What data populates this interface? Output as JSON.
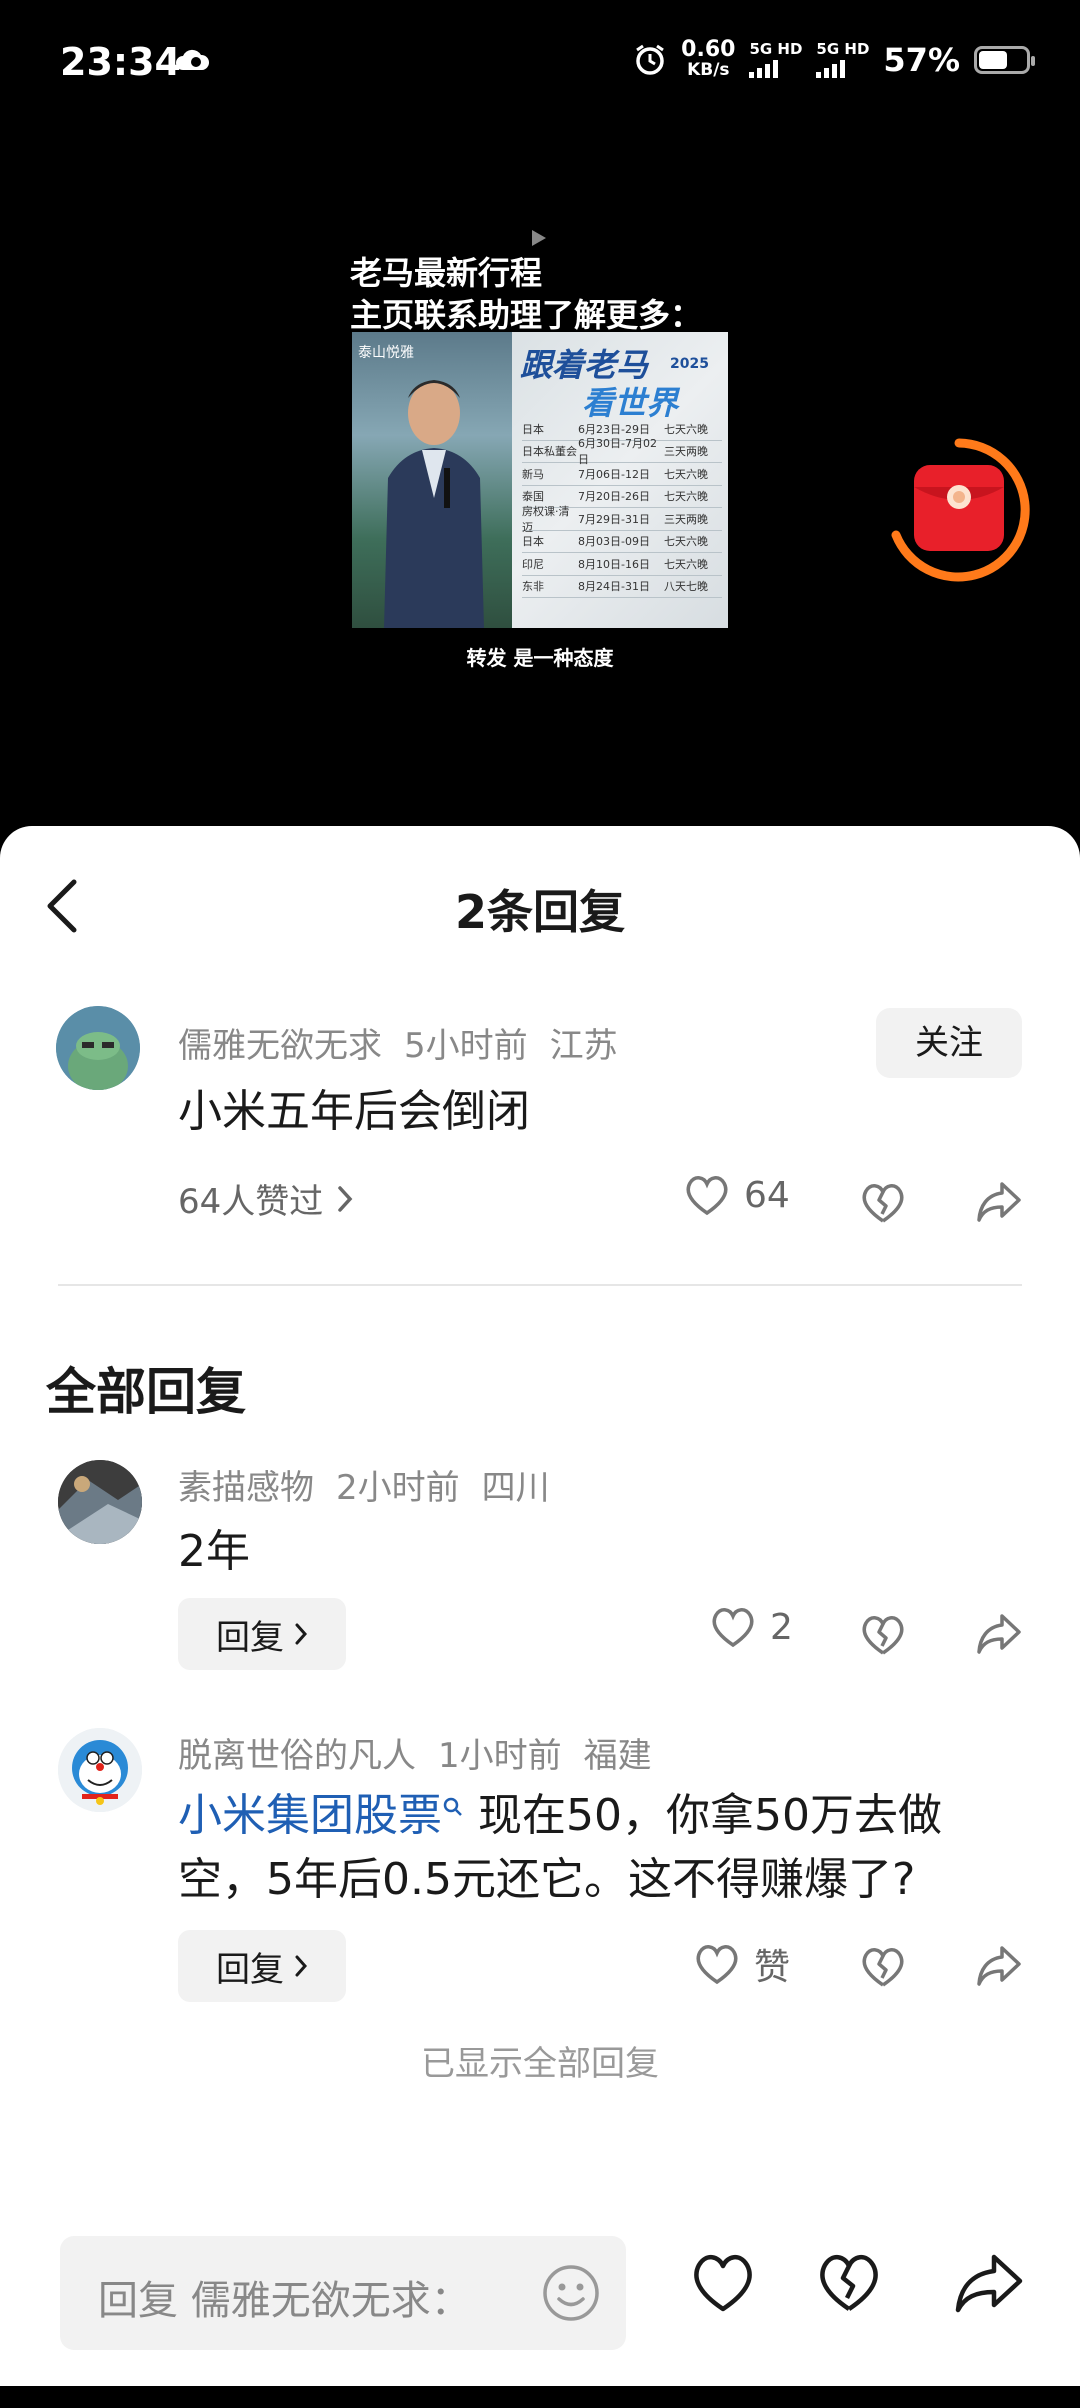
{
  "status_bar": {
    "time": "23:34",
    "net_speed_value": "0.60",
    "net_speed_unit": "KB/s",
    "sim1_label": "5G HD",
    "sim2_label": "5G HD",
    "battery_percent": "57%"
  },
  "video": {
    "title_line1": "老马最新行程",
    "title_line2": "主页联系助理了解更多：",
    "card_brand": "泰山悦雅",
    "card_headline": "跟着老马",
    "card_year": "2025",
    "card_headline2": "看世界",
    "trips": [
      {
        "country": "日本",
        "dates": "6月23日-29日",
        "days": "七天六晚"
      },
      {
        "country": "日本私董会",
        "dates": "6月30日-7月02日",
        "days": "三天两晚"
      },
      {
        "country": "新马",
        "dates": "7月06日-12日",
        "days": "七天六晚"
      },
      {
        "country": "泰国",
        "dates": "7月20日-26日",
        "days": "七天六晚"
      },
      {
        "country": "房权课·清迈",
        "dates": "7月29日-31日",
        "days": "三天两晚"
      },
      {
        "country": "日本",
        "dates": "8月03日-09日",
        "days": "七天六晚"
      },
      {
        "country": "印尼",
        "dates": "8月10日-16日",
        "days": "七天六晚"
      },
      {
        "country": "东非",
        "dates": "8月24日-31日",
        "days": "八天七晚"
      }
    ],
    "caption": "转发 是一种态度"
  },
  "sheet": {
    "title": "2条回复",
    "main_comment": {
      "user": "儒雅无欲无求",
      "time": "5小时前",
      "location": "江苏",
      "follow_label": "关注",
      "text": "小米五年后会倒闭",
      "likers": "64人赞过",
      "like_count": "64"
    },
    "section_title": "全部回复",
    "replies": [
      {
        "user": "素描感物",
        "time": "2小时前",
        "location": "四川",
        "text": "2年",
        "reply_label": "回复",
        "like_count": "2"
      },
      {
        "user": "脱离世俗的凡人",
        "time": "1小时前",
        "location": "福建",
        "link_text": "小米集团股票",
        "text_line1": "现在50，你拿50万去做",
        "text_line2": "空，5年后0.5元还它。这不得赚爆了?",
        "reply_label": "回复",
        "like_label": "赞"
      }
    ],
    "all_shown": "已显示全部回复"
  },
  "bottom_bar": {
    "placeholder": "回复 儒雅无欲无求："
  },
  "colors": {
    "accent_orange": "#ff7a1a",
    "redpacket": "#e8202a",
    "link_blue": "#1f5fb4"
  }
}
